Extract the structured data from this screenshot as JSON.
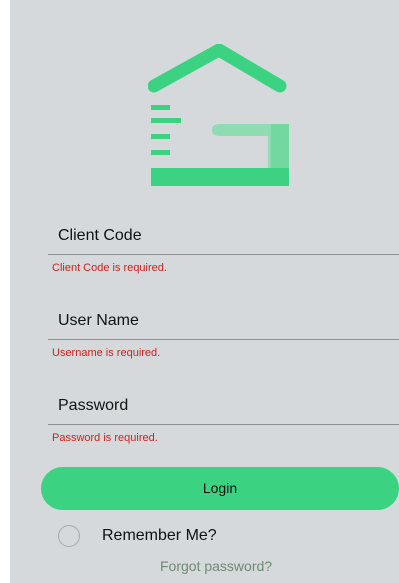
{
  "brand": {
    "logo_icon": "house-g-logo",
    "primary_color": "#3bd282"
  },
  "form": {
    "client_code": {
      "label": "Client Code",
      "error": "Client Code is required."
    },
    "user_name": {
      "label": "User Name",
      "error": "Username is required."
    },
    "password": {
      "label": "Password",
      "error": "Password is required."
    },
    "login_label": "Login",
    "remember_label": "Remember Me?",
    "remember_checked": false,
    "forgot_label": "Forgot password?"
  },
  "colors": {
    "background": "#d5d9dc",
    "error": "#d0201c",
    "link": "#6d8a72"
  }
}
